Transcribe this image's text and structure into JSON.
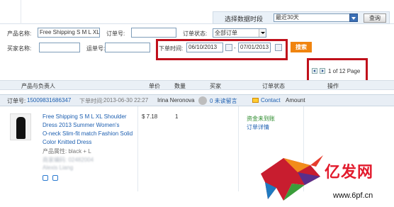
{
  "header": {
    "range_label": "选择数据时段",
    "range_value": "最近30天",
    "query_label": "查询"
  },
  "filters": {
    "product_name_label": "产品名称:",
    "product_name_value": "Free Shipping S M L XL",
    "order_no_label": "订单号:",
    "order_no_value": "",
    "order_status_label": "订单状态:",
    "order_status_value": "全部订单",
    "buyer_name_label": "买家名称:",
    "buyer_name_value": "",
    "tracking_no_label": "运单号:",
    "tracking_no_value": "",
    "order_time_label": "下单时间:",
    "date_from": "06/10/2013",
    "date_separator": "-",
    "date_to": "07/01/2013",
    "search_label": "搜索"
  },
  "pager": {
    "text": "1 of 12 Page"
  },
  "table": {
    "headers": [
      "产品与负责人",
      "单价",
      "数量",
      "买家",
      "订单状态",
      "操作"
    ]
  },
  "order": {
    "order_no_label": "订单号:",
    "order_no": "15009831686347",
    "order_time_label": "下单时间:",
    "order_time": "2013-06-30 22:27",
    "buyer": "Irina Neronova",
    "unread_msg": "0 未读留言",
    "contact": "Contact",
    "amount_label": "Amount"
  },
  "product": {
    "title_line1": "Free Shipping S M L XL Shoulder",
    "title_line2": "Dress 2013 Summer Women's",
    "title_line3": "O-neck Slim-fit match Fashion Solid",
    "title_line4": "Color Knitted Dress",
    "attr": "产品属性: black + L",
    "code": "商家编码: 02482004",
    "owner": "Alexis Liang",
    "price": "$ 7.18",
    "qty": "1",
    "status": "资金未到账",
    "detail": "订单详情"
  },
  "watermark": {
    "brand": "亿发网",
    "url": "www.6pf.cn"
  }
}
